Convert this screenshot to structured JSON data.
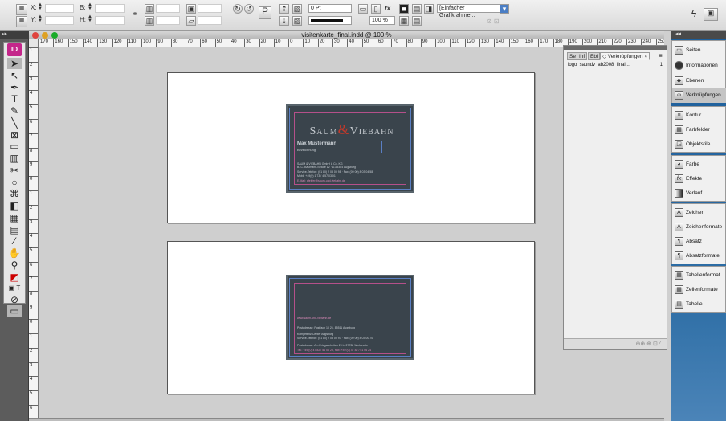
{
  "control_bar": {
    "x_label": "X:",
    "y_label": "Y:",
    "b_label": "B:",
    "h_label": "H:",
    "stroke_weight": "0 Pt",
    "scale": "100 %",
    "object_style": "[Einfacher Grafikrahme...",
    "fx_label": "fx"
  },
  "tools_panel": {
    "logo": "ID"
  },
  "document": {
    "title": "visitenkarte_final.indd @ 100 %",
    "ruler_h": [
      "170",
      "160",
      "150",
      "140",
      "130",
      "120",
      "110",
      "100",
      "90",
      "80",
      "70",
      "60",
      "50",
      "40",
      "30",
      "20",
      "10",
      "0",
      "10",
      "20",
      "30",
      "40",
      "50",
      "60",
      "70",
      "80",
      "90",
      "100",
      "110",
      "120",
      "130",
      "140",
      "150",
      "160",
      "170",
      "180",
      "190",
      "200",
      "210",
      "220",
      "230",
      "240",
      "250"
    ],
    "ruler_v": [
      "1",
      "2",
      "3",
      "4",
      "5",
      "6",
      "7",
      "8",
      "9",
      "0",
      "1",
      "2",
      "3",
      "4",
      "5",
      "6",
      "7",
      "8",
      "9",
      "0",
      "1",
      "2",
      "3",
      "4",
      "5",
      "6"
    ]
  },
  "card_front": {
    "logo_left": "Saum",
    "logo_amp": "&",
    "logo_right": "Viebahn",
    "name": "Max Mustermann",
    "role": "Bezeichnung",
    "lines": [
      "SAUM & VIEBAHN GmbH & Co. KG",
      "B.-C.-Baumann-Straße 12 · D-85354 Augsburg",
      "Service-Telefon: (01 80) 2 03 00 98 · Fax: (09 00) 8 03 04 58",
      "Mobil: +49(0) 1 73 / 4 57 03 01",
      "E-Mail: pfeiffer@saum-und-viebahn.de"
    ]
  },
  "card_back": {
    "web": "www.saum-und-viebahn.de",
    "lines": [
      "Postadresse: Postfach 10 26, 85511 Augsburg",
      "Kompetenz-Center Augsburg",
      "Service-Telefon: (01 80) 2 03 00 97 · Fax: (09 00) 8 03 00 70",
      "Postadresse: Am Kriegsanbeiten 29 b, 27738 Winklesste",
      "Tel.: +49 (0) 47 82 / 51 06 23, Fax: +49 (0) 47 82 / 51 06 24"
    ]
  },
  "links_panel": {
    "tabs": [
      "Se",
      "Inf",
      "Ebi",
      "◇ Verknüpfungen ×"
    ],
    "items": [
      {
        "name": "logo_saundv_ab2008_final...",
        "page": "1"
      }
    ]
  },
  "dock": {
    "group1": [
      "Seiten",
      "Informationen",
      "Ebenen",
      "Verknüpfungen"
    ],
    "group2": [
      "Kontur",
      "Farbfelder",
      "Objektstile"
    ],
    "group3": [
      "Farbe",
      "Effekte",
      "Verlauf"
    ],
    "group4": [
      "Zeichen",
      "Zeichenformate",
      "Absatz",
      "Absatzformate"
    ],
    "group5": [
      "Tabellenformat",
      "Zellenformate",
      "Tabelle"
    ]
  },
  "colors": {
    "dock_blue": "#2f6fa6",
    "card_bg": "#3a444c",
    "logo_red": "#c0392b",
    "guide_magenta": "#b5508a"
  }
}
